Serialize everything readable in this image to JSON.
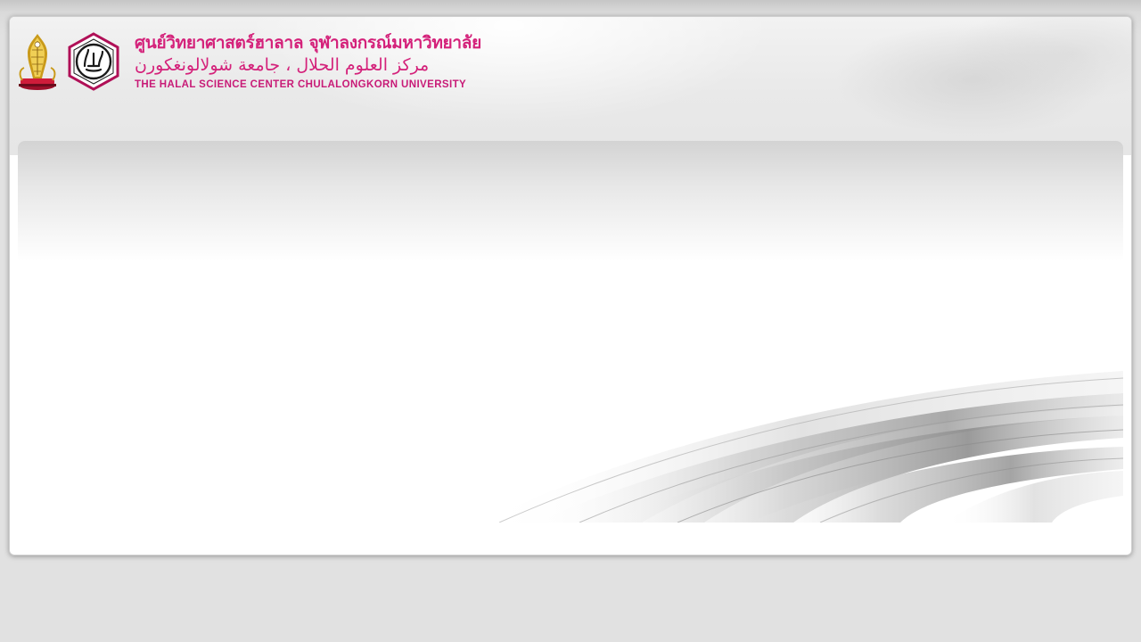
{
  "header": {
    "thai_name": "ศูนย์วิทยาศาสตร์ฮาลาล จุฬาลงกรณ์มหาวิทยาลัย",
    "arabic_name": "مركز العلوم الحلال ، جامعة شولالونغكورن",
    "english_name": "THE HALAL SCIENCE CENTER CHULALONGKORN UNIVERSITY",
    "logos": [
      "chulalongkorn-crest-icon",
      "halal-logo-icon"
    ]
  },
  "colors": {
    "brand_pink": "#d4217a",
    "page_background": "#e1e1e1",
    "panel_background": "#ffffff"
  }
}
